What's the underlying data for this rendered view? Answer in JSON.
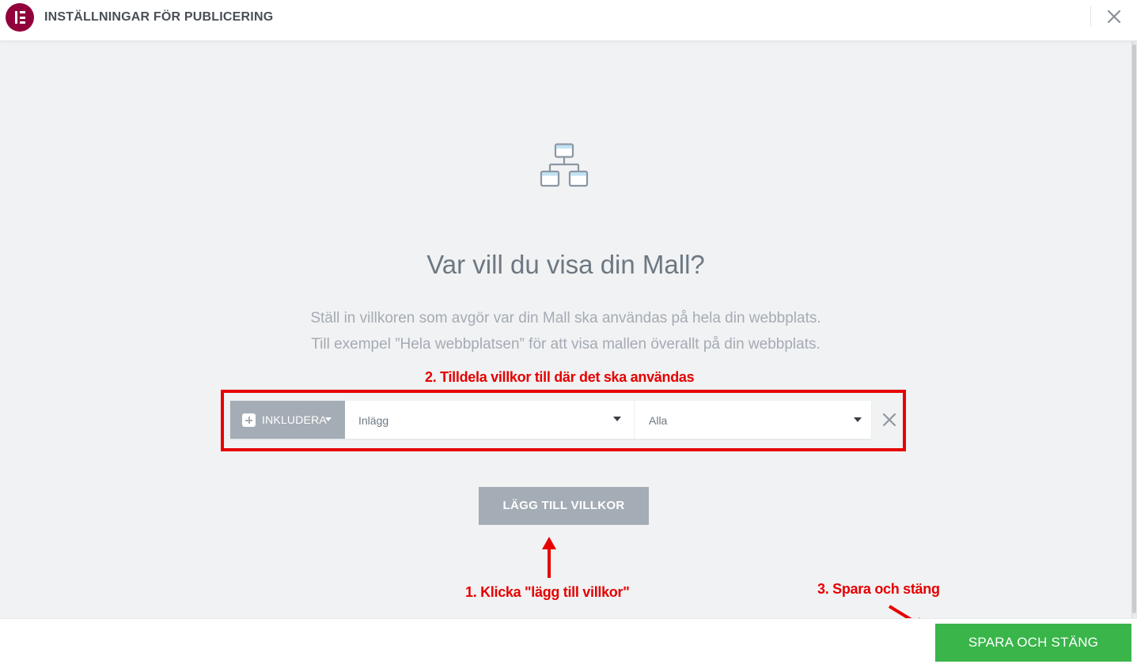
{
  "header": {
    "title": "INSTÄLLNINGAR FÖR PUBLICERING"
  },
  "main": {
    "heading": "Var vill du visa din Mall?",
    "description_line1": "Ställ in villkoren som avgör var din Mall ska användas på hela din webbplats.",
    "description_line2": "Till exempel ”Hela webbplatsen” för att visa mallen överallt på din webbplats.",
    "condition": {
      "type_label": "INKLUDERA",
      "select_1_value": "Inlägg",
      "select_2_value": "Alla"
    },
    "add_condition_label": "LÄGG TILL VILLKOR"
  },
  "annotations": {
    "step1": "1. Klicka \"lägg till villkor\"",
    "step2": "2. Tilldela villkor till där det ska användas",
    "step3": "3. Spara och stäng",
    "color": "#e60000"
  },
  "footer": {
    "save_label": "SPARA OCH STÄNG"
  },
  "colors": {
    "brand": "#92003b",
    "save": "#39b54a",
    "neutral_button": "#a4acb5",
    "background": "#f1f2f3"
  },
  "icons": {
    "logo": "elementor-logo-icon",
    "close": "close-icon",
    "sitemap": "sitemap-icon",
    "remove": "remove-condition-icon"
  }
}
